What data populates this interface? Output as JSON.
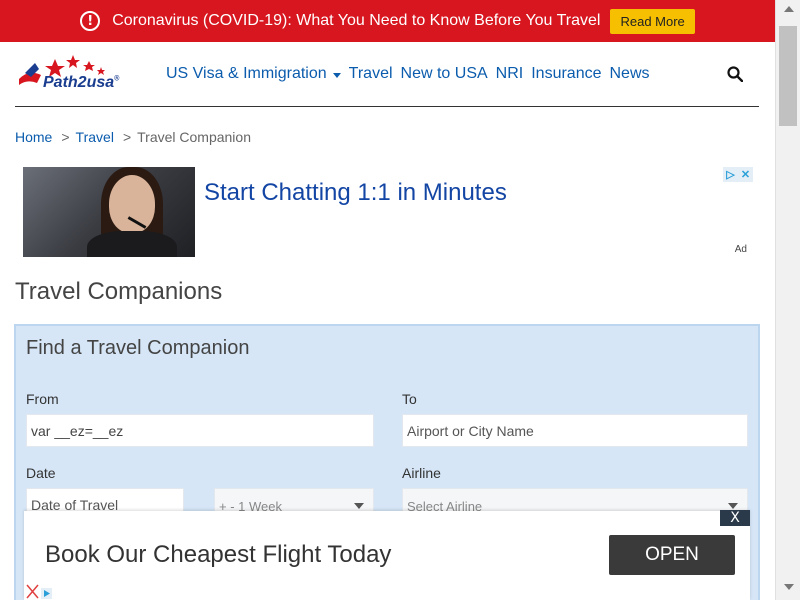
{
  "banner": {
    "icon": "info-icon",
    "icon_glyph": "!",
    "text": "Coronavirus (COVID-19): What You Need to Know Before You Travel",
    "button_label": "Read More",
    "color": "#d7161f"
  },
  "header": {
    "logo_text": "Path2usa",
    "logo_mark": "®",
    "nav": [
      {
        "label": "US Visa & Immigration"
      },
      {
        "label": "Travel"
      },
      {
        "label": "New to USA"
      },
      {
        "label": "NRI"
      },
      {
        "label": "Insurance"
      },
      {
        "label": "News"
      }
    ],
    "search_icon": "search-icon"
  },
  "breadcrumb": {
    "home": "Home",
    "sep": ">",
    "travel": "Travel",
    "current": "Travel Companion"
  },
  "ad_top": {
    "headline": "Start Chatting 1:1 in Minutes",
    "ad_label": "Ad",
    "icons": [
      "adchoices-icon",
      "close-icon"
    ]
  },
  "page": {
    "title": "Travel Companions"
  },
  "form": {
    "title": "Find a Travel Companion",
    "from_label": "From",
    "from_value": "var __ez=__ez",
    "to_label": "To",
    "to_placeholder": "Airport or City Name",
    "date_label": "Date",
    "date_placeholder": "Date of Travel",
    "range_value": "+ - 1 Week",
    "airline_label": "Airline",
    "airline_value": "Select Airline",
    "panel_color": "#d6e6f7"
  },
  "ad_bottom": {
    "headline": "Book Our Cheapest Flight Today",
    "button_label": "OPEN",
    "close_glyph": "X"
  }
}
